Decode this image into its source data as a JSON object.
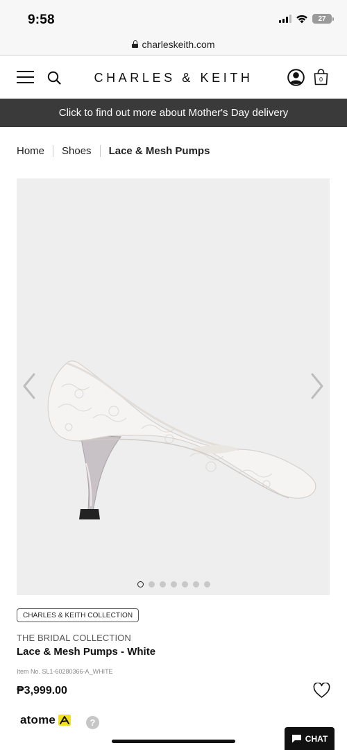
{
  "status_bar": {
    "time": "9:58",
    "battery": "27"
  },
  "browser": {
    "url": "charleskeith.com"
  },
  "header": {
    "brand": "CHARLES & KEITH",
    "bag_count": "0"
  },
  "promo": {
    "text": "Click to find out more about Mother's Day delivery"
  },
  "breadcrumb": {
    "items": [
      "Home",
      "Shoes",
      "Lace & Mesh Pumps"
    ]
  },
  "gallery": {
    "image_count": 7,
    "active_index": 0
  },
  "product": {
    "badge": "CHARLES & KEITH COLLECTION",
    "collection": "THE BRIDAL COLLECTION",
    "title": "Lace & Mesh Pumps - White",
    "item_number": "Item No. SL1-60280366-A_WHITE",
    "price": "₱3,999.00"
  },
  "payment": {
    "provider": "atome"
  },
  "chat": {
    "label": "CHAT"
  },
  "icons": [
    "menu-icon",
    "search-icon",
    "account-icon",
    "bag-icon",
    "lock-icon",
    "chevron-left-icon",
    "chevron-right-icon",
    "heart-icon",
    "help-icon",
    "chat-icon"
  ],
  "colors": {
    "banner": "#3a3a3a",
    "gallery_bg": "#eeeeee",
    "atome_accent": "#f0e020"
  }
}
